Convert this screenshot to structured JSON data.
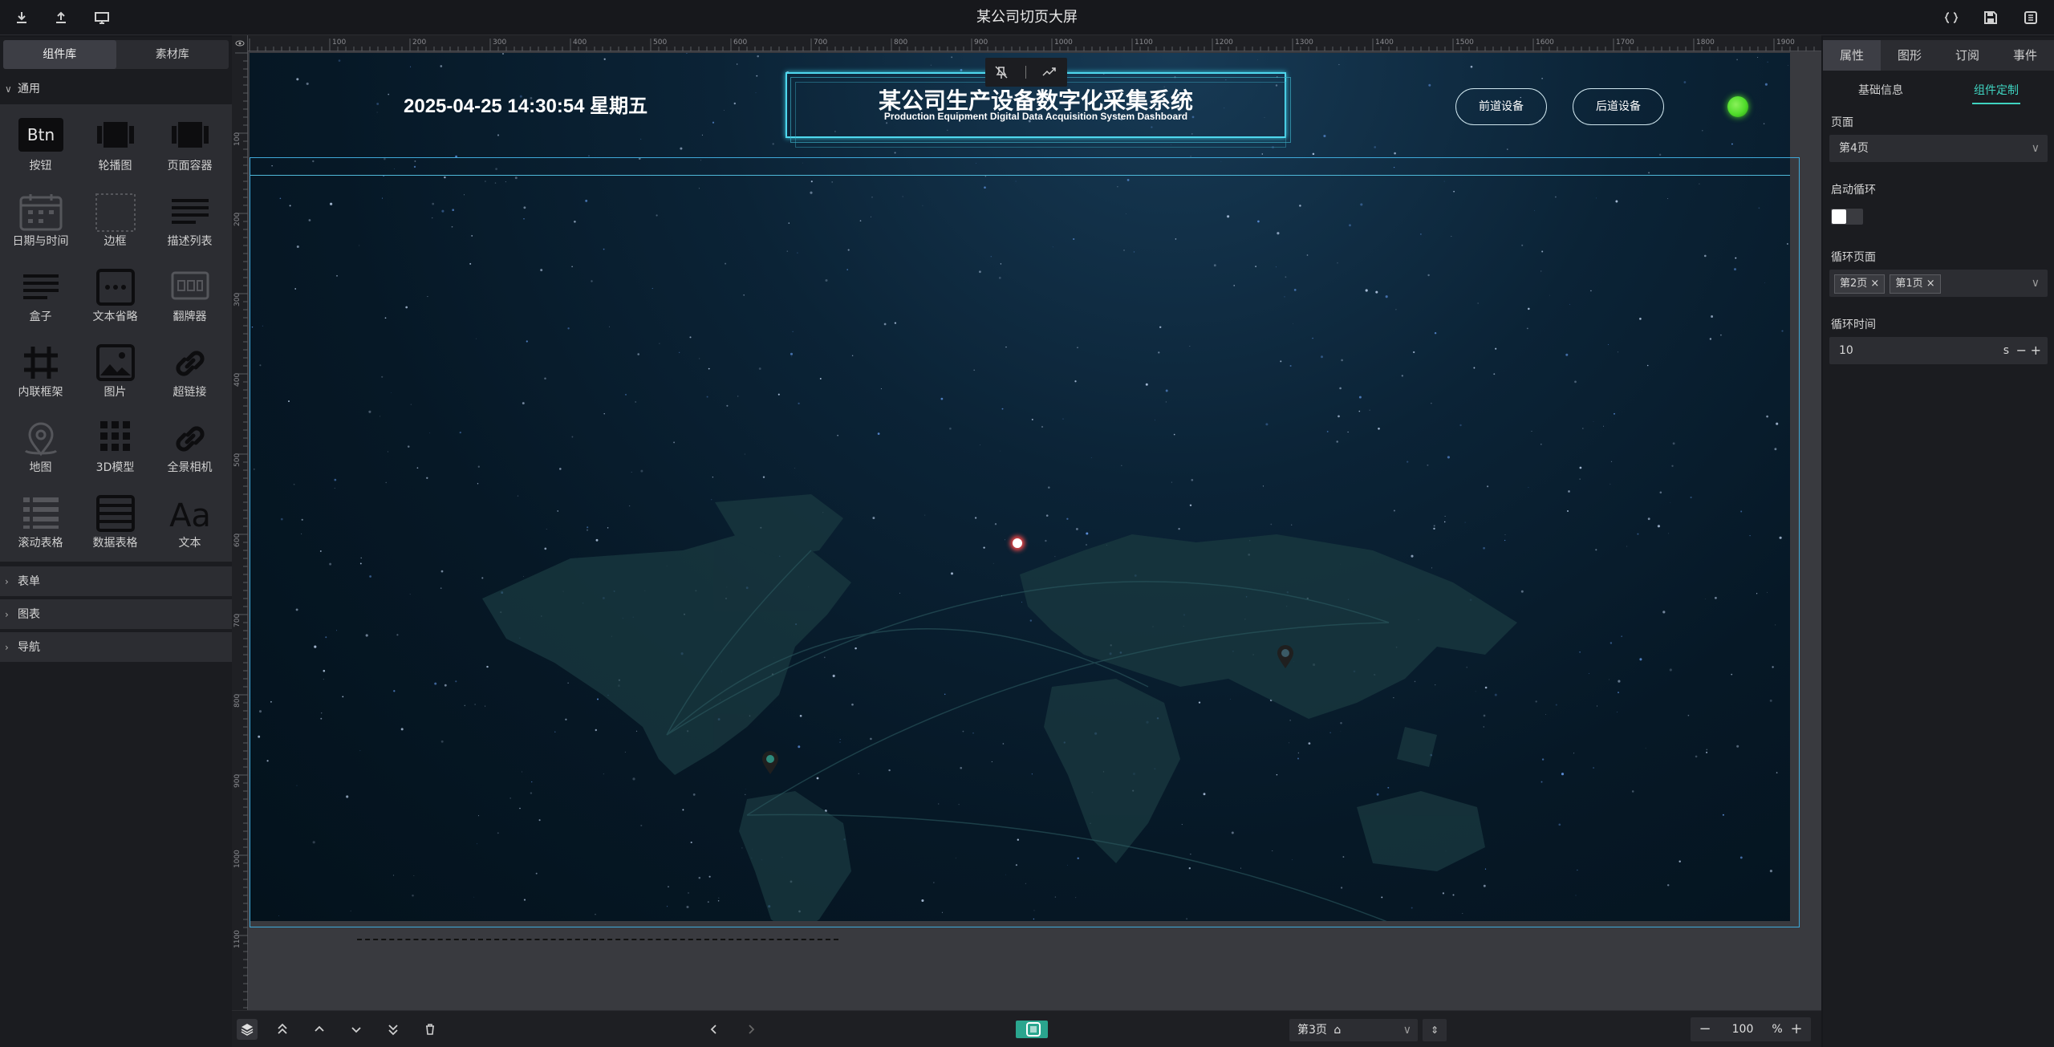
{
  "app": {
    "title": "某公司切页大屏"
  },
  "topbar": {
    "left_icons": [
      "download-icon",
      "upload-icon",
      "monitor-icon"
    ],
    "right_icons": [
      "code-braces-icon",
      "save-icon",
      "exit-icon"
    ]
  },
  "left_panel": {
    "tabs": [
      {
        "label": "组件库"
      },
      {
        "label": "素材库"
      }
    ],
    "sections": {
      "general": "通用",
      "form": "表单",
      "chart": "图表",
      "nav": "导航"
    },
    "components": [
      {
        "label": "按钮",
        "icon": "button-icon"
      },
      {
        "label": "轮播图",
        "icon": "carousel-icon"
      },
      {
        "label": "页面容器",
        "icon": "page-container-icon"
      },
      {
        "label": "日期与时间",
        "icon": "calendar-icon"
      },
      {
        "label": "边框",
        "icon": "border-icon"
      },
      {
        "label": "描述列表",
        "icon": "description-list-icon"
      },
      {
        "label": "盒子",
        "icon": "box-icon"
      },
      {
        "label": "文本省略",
        "icon": "ellipsis-icon"
      },
      {
        "label": "翻牌器",
        "icon": "flip-counter-icon"
      },
      {
        "label": "内联框架",
        "icon": "iframe-icon"
      },
      {
        "label": "图片",
        "icon": "image-icon"
      },
      {
        "label": "超链接",
        "icon": "link-icon"
      },
      {
        "label": "地图",
        "icon": "map-icon"
      },
      {
        "label": "3D模型",
        "icon": "model-3d-icon"
      },
      {
        "label": "全景相机",
        "icon": "panorama-camera-icon"
      },
      {
        "label": "滚动表格",
        "icon": "scroll-table-icon"
      },
      {
        "label": "数据表格",
        "icon": "data-table-icon"
      },
      {
        "label": "文本",
        "icon": "text-icon"
      }
    ],
    "button_icon_text": "Btn",
    "text_icon_text": "Aa"
  },
  "canvas": {
    "datetime": "2025-04-25 14:30:54 星期五",
    "header_title": "某公司生产设备数字化采集系统",
    "header_subtitle": "Production Equipment Digital Data Acquisition System Dashboard",
    "btn_prev": "前道设备",
    "btn_next": "后道设备",
    "status_color": "#4fdc2a",
    "ruler_ticks": [
      "100",
      "200",
      "300",
      "400",
      "500",
      "600",
      "700",
      "800",
      "900",
      "1000",
      "1100",
      "1200",
      "1300",
      "1400",
      "1500",
      "1600",
      "1700",
      "1800",
      "1900"
    ],
    "ruler_left_ticks": [
      "100",
      "200",
      "300",
      "400",
      "500",
      "600",
      "700",
      "800",
      "900",
      "1000",
      "1100"
    ]
  },
  "bottombar": {
    "page_select": "第3页",
    "zoom": "100",
    "zoom_unit": "%"
  },
  "right_panel": {
    "tabs": [
      {
        "label": "属性"
      },
      {
        "label": "图形"
      },
      {
        "label": "订阅"
      },
      {
        "label": "事件"
      }
    ],
    "subtabs": [
      {
        "label": "基础信息"
      },
      {
        "label": "组件定制"
      }
    ],
    "page_label": "页面",
    "page_value": "第4页",
    "loop_label": "启动循环",
    "loop_pages_label": "循环页面",
    "loop_pages": [
      "第2页",
      "第1页"
    ],
    "loop_time_label": "循环时间",
    "loop_time_value": "10",
    "loop_time_unit": "s",
    "accent": "#3fd3c0"
  }
}
